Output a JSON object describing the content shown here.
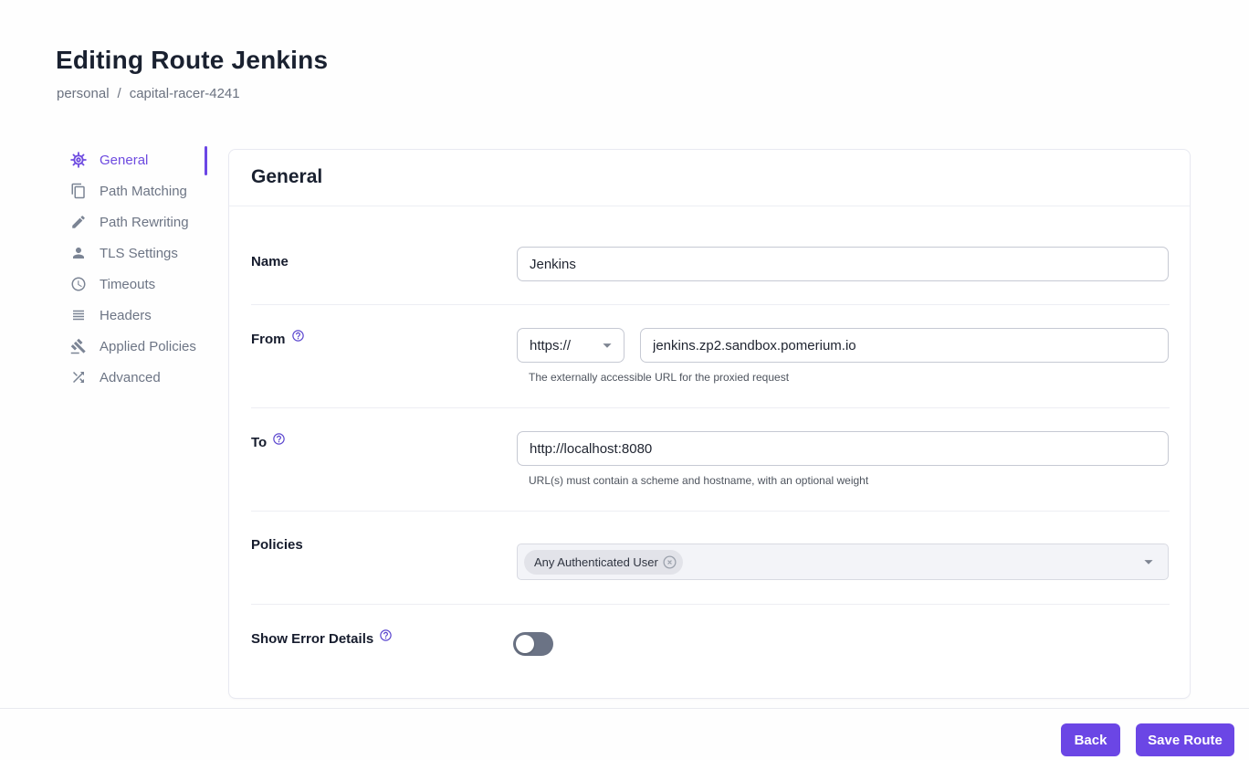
{
  "page": {
    "title": "Editing Route Jenkins",
    "breadcrumb": {
      "org": "personal",
      "separator": "/",
      "project": "capital-racer-4241"
    }
  },
  "sidebar": {
    "items": [
      {
        "label": "General",
        "icon": "gear-icon",
        "active": true
      },
      {
        "label": "Path Matching",
        "icon": "copy-icon",
        "active": false
      },
      {
        "label": "Path Rewriting",
        "icon": "pencil-icon",
        "active": false
      },
      {
        "label": "TLS Settings",
        "icon": "person-icon",
        "active": false
      },
      {
        "label": "Timeouts",
        "icon": "clock-icon",
        "active": false
      },
      {
        "label": "Headers",
        "icon": "list-lines-icon",
        "active": false
      },
      {
        "label": "Applied Policies",
        "icon": "gavel-icon",
        "active": false
      },
      {
        "label": "Advanced",
        "icon": "shuffle-icon",
        "active": false
      }
    ]
  },
  "panel": {
    "title": "General",
    "fields": {
      "name": {
        "label": "Name",
        "value": "Jenkins"
      },
      "from": {
        "label": "From",
        "help_icon": "help-circle-icon",
        "scheme": "https://",
        "value": "jenkins.zp2.sandbox.pomerium.io",
        "helper": "The externally accessible URL for the proxied request"
      },
      "to": {
        "label": "To",
        "help_icon": "help-circle-icon",
        "value": "http://localhost:8080",
        "helper": "URL(s) must contain a scheme and hostname, with an optional weight"
      },
      "policies": {
        "label": "Policies",
        "chips": [
          "Any Authenticated User"
        ],
        "chip_delete_icon": "circle-x-icon",
        "dropdown_icon": "caret-down-icon"
      },
      "show_error_details": {
        "label": "Show Error Details",
        "help_icon": "help-circle-icon",
        "enabled": false
      }
    }
  },
  "footer": {
    "back_label": "Back",
    "save_label": "Save Route"
  },
  "colors": {
    "accent": "#6b46e5",
    "active_nav": "#6e4be0",
    "title_text": "#1a2130",
    "muted_text": "#6b7280",
    "toggle_track_off": "#6b7385"
  }
}
